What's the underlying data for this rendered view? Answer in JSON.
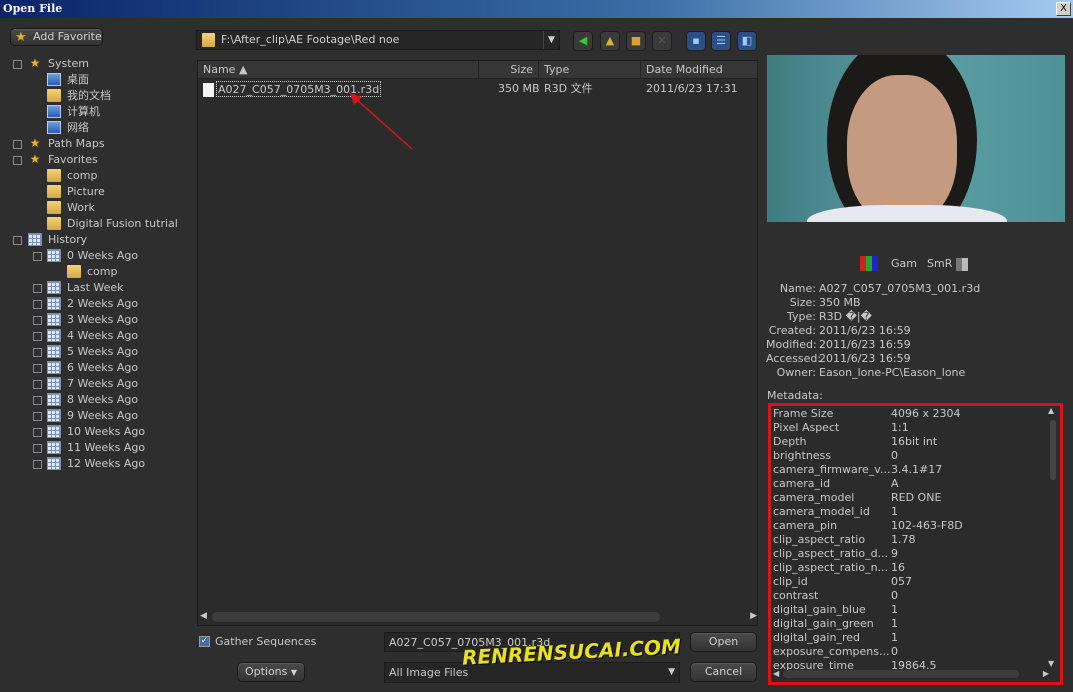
{
  "window": {
    "title": "Open File",
    "close": "X"
  },
  "sidebar": {
    "add_favorite": "Add Favorite",
    "tree": [
      {
        "label": "System",
        "level": 0,
        "icon": "star",
        "cb": true
      },
      {
        "label": "桌面",
        "level": 1,
        "icon": "desktop",
        "cb": false
      },
      {
        "label": "我的文档",
        "level": 1,
        "icon": "documents",
        "cb": false
      },
      {
        "label": "计算机",
        "level": 1,
        "icon": "computer",
        "cb": false
      },
      {
        "label": "网络",
        "level": 1,
        "icon": "network",
        "cb": false
      },
      {
        "label": "Path Maps",
        "level": 0,
        "icon": "star",
        "cb": true
      },
      {
        "label": "Favorites",
        "level": 0,
        "icon": "star",
        "cb": true
      },
      {
        "label": "comp",
        "level": 1,
        "icon": "folder",
        "cb": false
      },
      {
        "label": "Picture",
        "level": 1,
        "icon": "folder",
        "cb": false
      },
      {
        "label": "Work",
        "level": 1,
        "icon": "folder",
        "cb": false
      },
      {
        "label": "Digital Fusion tutrial",
        "level": 1,
        "icon": "folder",
        "cb": false
      },
      {
        "label": "History",
        "level": 0,
        "icon": "calendar",
        "cb": true
      },
      {
        "label": "0 Weeks Ago",
        "level": 1,
        "icon": "calendar",
        "cb": true
      },
      {
        "label": "comp",
        "level": 2,
        "icon": "folder",
        "cb": false
      },
      {
        "label": "Last Week",
        "level": 1,
        "icon": "calendar",
        "cb": true
      },
      {
        "label": "2 Weeks Ago",
        "level": 1,
        "icon": "calendar",
        "cb": true
      },
      {
        "label": "3 Weeks Ago",
        "level": 1,
        "icon": "calendar",
        "cb": true
      },
      {
        "label": "4 Weeks Ago",
        "level": 1,
        "icon": "calendar",
        "cb": true
      },
      {
        "label": "5 Weeks Ago",
        "level": 1,
        "icon": "calendar",
        "cb": true
      },
      {
        "label": "6 Weeks Ago",
        "level": 1,
        "icon": "calendar",
        "cb": true
      },
      {
        "label": "7 Weeks Ago",
        "level": 1,
        "icon": "calendar",
        "cb": true
      },
      {
        "label": "8 Weeks Ago",
        "level": 1,
        "icon": "calendar",
        "cb": true
      },
      {
        "label": "9 Weeks Ago",
        "level": 1,
        "icon": "calendar",
        "cb": true
      },
      {
        "label": "10 Weeks Ago",
        "level": 1,
        "icon": "calendar",
        "cb": true
      },
      {
        "label": "11 Weeks Ago",
        "level": 1,
        "icon": "calendar",
        "cb": true
      },
      {
        "label": "12 Weeks Ago",
        "level": 1,
        "icon": "calendar",
        "cb": true
      }
    ]
  },
  "path": {
    "value": "F:\\After_clip\\AE Footage\\Red noe"
  },
  "toolbar": {
    "icons": [
      "back-icon",
      "up-folder-icon",
      "new-folder-icon",
      "delete-icon",
      "view-icons-icon",
      "view-list-icon",
      "view-details-icon"
    ]
  },
  "files": {
    "columns": {
      "name": "Name ▲",
      "size": "Size",
      "type": "Type",
      "date": "Date Modified"
    },
    "rows": [
      {
        "name": "A027_C057_0705M3_001.r3d",
        "size": "350 MB",
        "type": "R3D 文件",
        "date": "2011/6/23 17:31"
      }
    ]
  },
  "preview": {
    "channels_label": "Gam",
    "smr_label": "SmR"
  },
  "info": [
    {
      "k": "Name:",
      "v": "A027_C057_0705M3_001.r3d"
    },
    {
      "k": "Size:",
      "v": "350 MB"
    },
    {
      "k": "Type:",
      "v": "R3D �|�"
    },
    {
      "k": "Created:",
      "v": "2011/6/23 16:59"
    },
    {
      "k": "Modified:",
      "v": "2011/6/23 16:59"
    },
    {
      "k": "Accessed:",
      "v": "2011/6/23 16:59"
    },
    {
      "k": "Owner:",
      "v": "Eason_lone-PC\\Eason_lone"
    }
  ],
  "metadata_label": "Metadata:",
  "metadata": [
    [
      "Frame Size",
      "4096 x 2304"
    ],
    [
      "Pixel Aspect",
      "1:1"
    ],
    [
      "Depth",
      "16bit int"
    ],
    [
      "brightness",
      "0"
    ],
    [
      "camera_firmware_v...",
      "3.4.1#17"
    ],
    [
      "camera_id",
      "A"
    ],
    [
      "camera_model",
      "RED ONE"
    ],
    [
      "camera_model_id",
      "1"
    ],
    [
      "camera_pin",
      "102-463-F8D"
    ],
    [
      "clip_aspect_ratio",
      "1.78"
    ],
    [
      "clip_aspect_ratio_d...",
      "9"
    ],
    [
      "clip_aspect_ratio_n...",
      "16"
    ],
    [
      "clip_id",
      "057"
    ],
    [
      "contrast",
      "0"
    ],
    [
      "digital_gain_blue",
      "1"
    ],
    [
      "digital_gain_green",
      "1"
    ],
    [
      "digital_gain_red",
      "1"
    ],
    [
      "exposure_compens...",
      "0"
    ],
    [
      "exposure_time",
      "19864.5"
    ]
  ],
  "bottom": {
    "gather_sequences": "Gather Sequences",
    "gather_checked": true,
    "filename": "A027_C057_0705M3_001.r3d",
    "filter": "All Image Files",
    "open": "Open",
    "cancel": "Cancel",
    "options": "Options"
  },
  "colors": {
    "highlight": "#d8141a",
    "background": "#2e2e2e"
  }
}
